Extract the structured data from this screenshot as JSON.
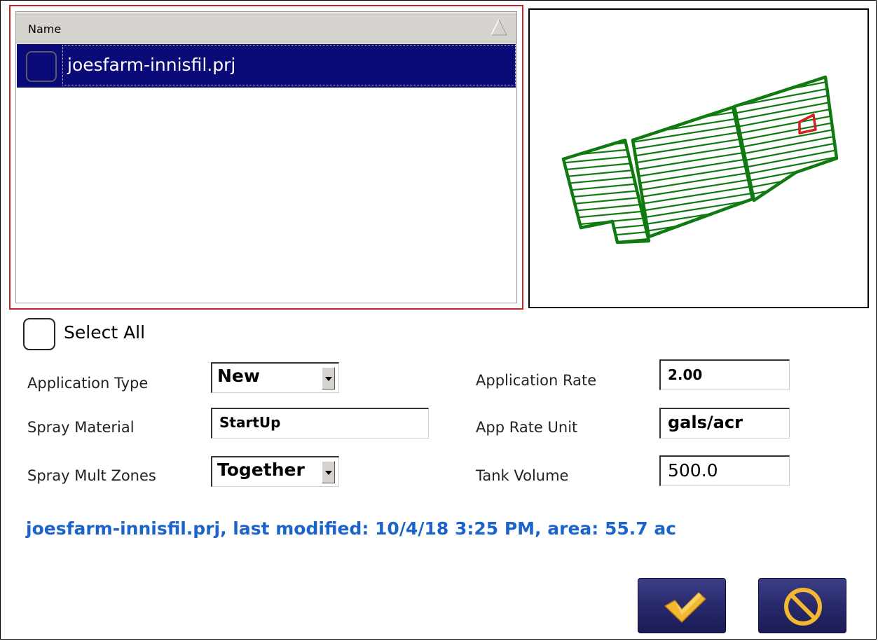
{
  "file_list": {
    "header_label": "Name",
    "rows": [
      {
        "label": "joesfarm-innisfil.prj",
        "checked": false,
        "selected": true
      }
    ]
  },
  "select_all": {
    "label": "Select All",
    "checked": false
  },
  "form": {
    "application_type": {
      "label": "Application Type",
      "value": "New"
    },
    "spray_material": {
      "label": "Spray Material",
      "value": "StartUp"
    },
    "spray_mult_zones": {
      "label": "Spray Mult Zones",
      "value": "Together"
    },
    "application_rate": {
      "label": "Application Rate",
      "value": "2.00"
    },
    "app_rate_unit": {
      "label": "App Rate Unit",
      "value": "gals/acr"
    },
    "tank_volume": {
      "label": "Tank Volume",
      "value": "500.0"
    }
  },
  "status_line": "joesfarm-innisfil.prj, last modified: 10/4/18 3:25 PM, area: 55.7 ac",
  "buttons": {
    "ok_icon": "checkmark-icon",
    "cancel_icon": "prohibited-icon"
  },
  "colors": {
    "selection_bg": "#0a0a78",
    "list_border": "#c0262a",
    "field_outline": "#0f7a0f",
    "marker_outline": "#d42020",
    "status_text": "#1c64c9",
    "button_bg": "#2a2b6e",
    "checkmark": "#f2b830"
  }
}
